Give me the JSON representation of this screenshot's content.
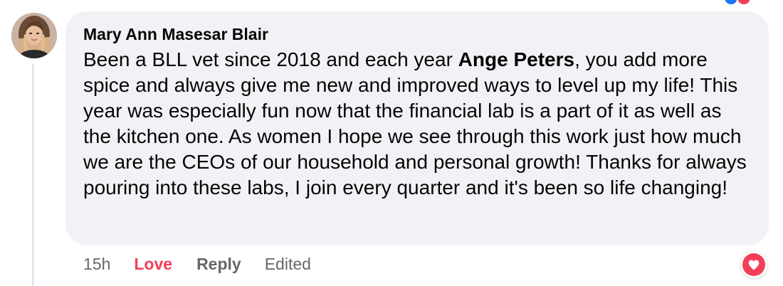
{
  "comment": {
    "author": "Mary Ann Masesar Blair",
    "text_before_mention": "Been a BLL vet since 2018 and each year ",
    "mention": "Ange Peters",
    "text_after_mention": ", you add more spice and always give me new and improved ways to level up my life! This year was especially fun now that the financial lab is a part of it as well as the kitchen one. As women I hope we see through this work just how much we are the CEOs of our household and personal growth! Thanks for always pouring into these labs, I join every quarter and it's been so life changing!",
    "bubble_color": "#f0f2f5"
  },
  "actions": {
    "timestamp": "15h",
    "love_label": "Love",
    "reply_label": "Reply",
    "edited_label": "Edited",
    "love_color": "#f33e58",
    "muted_color": "#65676b"
  },
  "reactions": {
    "comment_reaction_icon": "love-heart-icon",
    "top_reaction_icons": [
      "like-icon",
      "love-icon"
    ]
  }
}
